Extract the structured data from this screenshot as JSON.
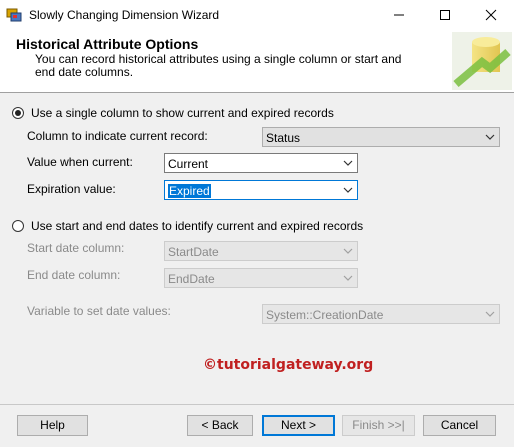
{
  "window": {
    "title": "Slowly Changing Dimension Wizard",
    "controls": [
      "minimize-icon",
      "maximize-icon",
      "close-icon"
    ]
  },
  "header": {
    "title": "Historical Attribute Options",
    "description": "You can record historical attributes using a single column or start and end date columns."
  },
  "option_single_column": {
    "label": "Use a single column to show current and expired records",
    "selected": true,
    "column_label": "Column to indicate current record:",
    "column_value": "Status",
    "current_label": "Value when current:",
    "current_value": "Current",
    "expiration_label": "Expiration value:",
    "expiration_value": "Expired"
  },
  "option_dates": {
    "label": "Use start and end dates to identify current and expired records",
    "selected": false,
    "start_label": "Start date column:",
    "start_value": "StartDate",
    "end_label": "End date column:",
    "end_value": "EndDate",
    "variable_label": "Variable to set date values:",
    "variable_value": "System::CreationDate"
  },
  "watermark": "©tutorialgateway.org",
  "buttons": {
    "help": "Help",
    "back": "< Back",
    "next": "Next >",
    "finish": "Finish >>|",
    "cancel": "Cancel"
  },
  "colors": {
    "selection": "#0078d7",
    "background": "#f0f0f0",
    "watermark": "#c02020"
  }
}
